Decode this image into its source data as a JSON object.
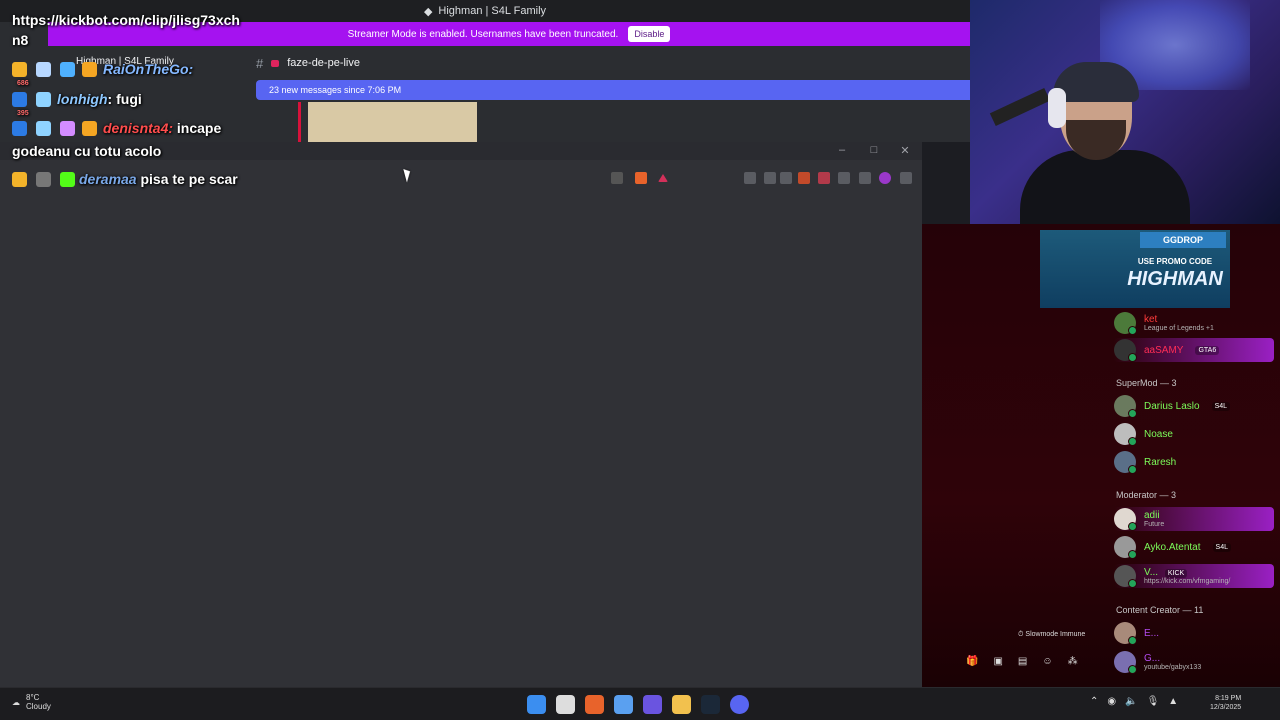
{
  "discord": {
    "window_title": "Highman | S4L Family",
    "streamer_banner": "Streamer Mode is enabled. Usernames have been truncated.",
    "disable_label": "Disable",
    "server_name": "Highman | S4L Family",
    "channel_hash": "#",
    "channel_name": "faze-de-pe-live",
    "new_messages": "23 new messages since 7:06 PM"
  },
  "kick_chat": {
    "line1": "https://kickbot.com/clip/jlisg73xch",
    "line2": "n8",
    "msg1_name": "RaiOnTheGo:",
    "msg2_name": "lonhigh",
    "msg2_text": ": fugi",
    "msg3_name": "denisnta4:",
    "msg3_text": " incape",
    "msg3_cont": "godeanu cu totu acolo",
    "msg4_name": "deramaa",
    "msg4_text": "pisa te pe scar",
    "badge_count1": "686",
    "badge_count2": "395"
  },
  "promo": {
    "brand": "GGDROP",
    "line": "USE PROMO CODE",
    "code": "HIGHMAN"
  },
  "members": {
    "top": {
      "name": "ket",
      "sub": "League of Legends +1"
    },
    "highlight1": {
      "name": "aaSAMY",
      "tag": "GTA6"
    },
    "supermod_header": "SuperMod — 3",
    "supermods": [
      {
        "name": "Darius Laslo",
        "tag": "S4L"
      },
      {
        "name": "Noase"
      },
      {
        "name": "Raresh"
      }
    ],
    "moderator_header": "Moderator — 3",
    "moderators": [
      {
        "name": "adii",
        "sub": "Future"
      },
      {
        "name": "Ayko.Atentat",
        "tag": "S4L"
      },
      {
        "name": "V...",
        "tag": "KICK",
        "sub": "https://kick.com/vfmgaming/"
      }
    ],
    "creator_header": "Content Creator — 11",
    "creators": [
      {
        "name": "E..."
      },
      {
        "name": "G...",
        "sub": "youtube/gabyx133"
      }
    ]
  },
  "slowmode": "Slowmode Immune",
  "taskbar": {
    "temp": "8°C",
    "weather": "Cloudy",
    "time": "8:19 PM",
    "date": "12/3/2025"
  },
  "colors": {
    "banner": "#a512f0",
    "new_messages": "#5865f2",
    "browser": "#303136",
    "right_panel": "#2f0309"
  }
}
